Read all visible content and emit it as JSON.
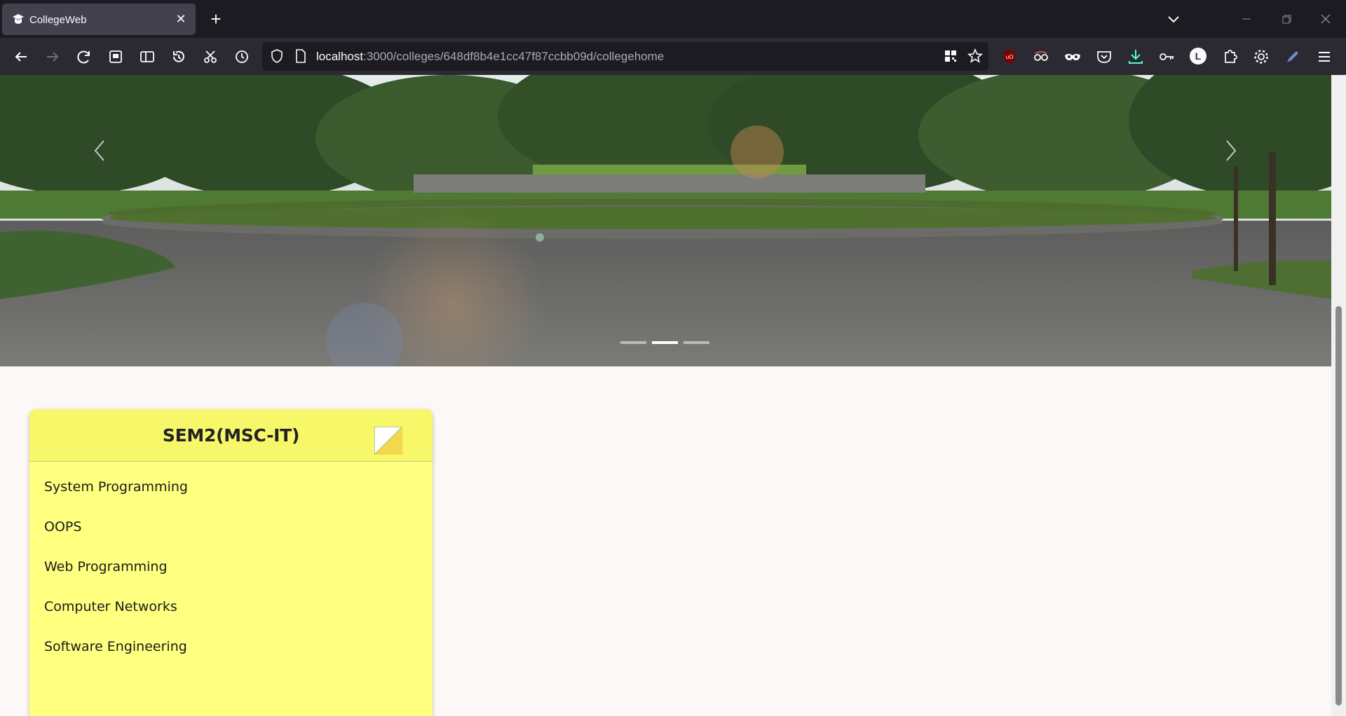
{
  "browser": {
    "tab": {
      "title": "CollegeWeb",
      "close_glyph": "✕"
    },
    "new_tab_glyph": "+",
    "url": {
      "host": "localhost",
      "rest": ":3000/colleges/648df8b4e1cc47f87ccbb09d/collegehome"
    },
    "extensions_badge_letter": "L"
  },
  "carousel": {
    "slides": 3,
    "active_index": 1
  },
  "card": {
    "title": "SEM2(MSC-IT)",
    "color": "#ffff80",
    "header_color": "#f7f76a",
    "subjects": [
      "System Programming",
      "OOPS",
      "Web Programming",
      "Computer Networks",
      "Software Engineering"
    ]
  },
  "colors": {
    "tab_bg": "#42414d",
    "toolbar_bg": "#2b2a33",
    "urlbar_bg": "#1c1b22",
    "page_bg": "#fdf8f8"
  },
  "icons": [
    "college-favicon",
    "back-icon",
    "forward-icon",
    "reload-icon",
    "history-icon",
    "gear-icon",
    "shield-icon",
    "page-icon",
    "star-icon",
    "download-icon",
    "key-icon",
    "menu-icon"
  ]
}
